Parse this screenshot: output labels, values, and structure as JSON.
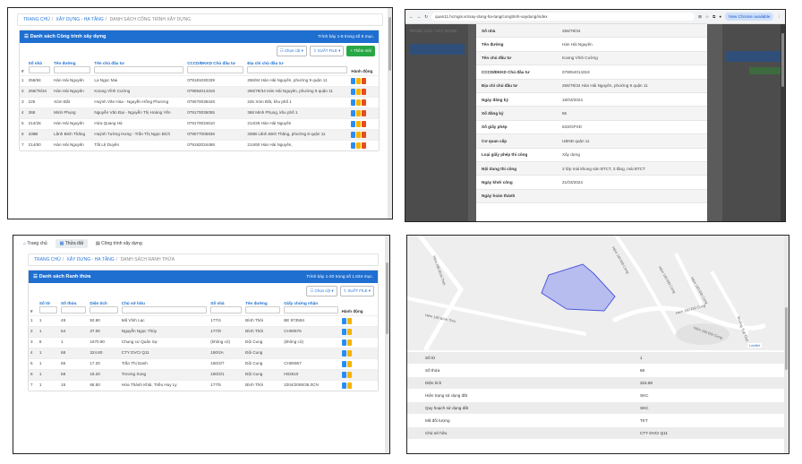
{
  "colors": {
    "primary": "#1f6fd1",
    "success": "#28a745",
    "warning": "#f5b400",
    "danger": "#e84c1e"
  },
  "panel1": {
    "breadcrumb": [
      "TRANG CHỦ",
      "XÂY DỰNG - HẠ TẦNG",
      "DANH SÁCH CÔNG TRÌNH XÂY DỰNG"
    ],
    "title": "Danh sách Công trình xây dựng",
    "count_text": "Trình bày 1-8 trong số 8 mục.",
    "btn_columns": "Chọn cột",
    "btn_export": "XUẤT FILE",
    "btn_add": "+ Thêm mới",
    "columns": [
      "#",
      "Số nhà",
      "Tên đường",
      "Tên chủ đầu tư",
      "CCCD/ĐKKD Chủ đầu tư",
      "Địa chỉ chủ đầu tư",
      "Hành động"
    ],
    "rows": [
      {
        "n": "1",
        "so_nha": "256/84",
        "duong": "Hàn Hải Nguyên",
        "chu": "La Ngọc Mai",
        "cccd": "079181030339",
        "dia_chi": "256/84 Hàn Hải Nguyên, phường 9 quận 11"
      },
      {
        "n": "2",
        "so_nha": "256/78/34",
        "duong": "Hàn Hải Nguyên",
        "chu": "Koong Vĩnh Cường",
        "cccd": "079054014318",
        "dia_chi": "256/78/34 Hàn Hải Nguyên, phường 9 quận 11"
      },
      {
        "n": "3",
        "so_nha": "225",
        "duong": "Xóm Đất",
        "chu": "Huỳnh Văn Hòa - Nguyễn Hồng Phương",
        "cccd": "079070038428",
        "dia_chi": "225 Xóm Đất, khu phố 1"
      },
      {
        "n": "4",
        "so_nha": "368",
        "duong": "Minh Phụng",
        "chu": "Nguyễn Văn Đại - Nguyễn Thị Hoàng Yến",
        "cccd": "079170035055",
        "dia_chi": "368 Minh Phụng, khu phố 1"
      },
      {
        "n": "5",
        "so_nha": "214/26",
        "duong": "Hàn Hải Nguyên",
        "chu": "Hứa Quang Hà",
        "cccd": "079170034610",
        "dia_chi": "214/26 Hàn Hải Nguyên"
      },
      {
        "n": "6",
        "so_nha": "339B",
        "duong": "Lãnh Binh Thăng",
        "chu": "Huỳnh Tường Hưng - Trần Thị Ngọc Bích",
        "cccd": "079077005938",
        "dia_chi": "339B Lãnh Binh Thăng, phường 8 quận 11"
      },
      {
        "n": "7",
        "so_nha": "214/60",
        "duong": "Hàn Hải Nguyên",
        "chu": "Tất Lệ Duyên",
        "cccd": "079182034488",
        "dia_chi": "214/60 Hàn Hải Nguyên,"
      }
    ]
  },
  "panel2": {
    "url": "quan11.hcmgis.vn/xay-dung-ha-tang/congtrinh-xaydung/index",
    "new_chrome": "New Chrome available",
    "bg_labels": [
      "TRANG CHỦ",
      "XÂY DỰNG"
    ],
    "fields": [
      {
        "k": "Số nhà",
        "v": "256/78/34"
      },
      {
        "k": "Tên đường",
        "v": "Hàn Hải Nguyên"
      },
      {
        "k": "Tên chủ đầu tư",
        "v": "Koong Vĩnh Cường"
      },
      {
        "k": "CCCD/ĐKKD Chủ đầu tư",
        "v": "079054014318"
      },
      {
        "k": "Địa chỉ chủ đầu tư",
        "v": "256/78/34 Hàn Hải Nguyên, phường 9 quận 11"
      },
      {
        "k": "Ngày đăng ký",
        "v": "18/03/2024"
      },
      {
        "k": "Số đăng ký",
        "v": "65"
      },
      {
        "k": "Số giấy phép",
        "v": "633/GPXD"
      },
      {
        "k": "Cơ quan cấp",
        "v": "UBND quận 11"
      },
      {
        "k": "Loại giấy phép thi công",
        "v": "Xây dựng"
      },
      {
        "k": "Nội dung thi công",
        "v": "3 lớp mái khung sàn BTCT, 3 tầng, mái BTCT"
      },
      {
        "k": "Ngày khởi công",
        "v": "21/03/2024"
      },
      {
        "k": "Ngày hoàn thành",
        "v": ""
      }
    ]
  },
  "panel3": {
    "tabs": [
      "Trang chủ",
      "Thửa đất",
      "Công trình xây dựng"
    ],
    "breadcrumb": [
      "TRANG CHỦ",
      "XÂY DỰNG - HẠ TẦNG",
      "DANH SÁCH RANH THỬA"
    ],
    "title": "Danh sách Ranh thửa",
    "count_text": "Trình bày 1-20 trong số 1.634 mục.",
    "btn_columns": "Chọn cột",
    "btn_export": "XUẤT FILE",
    "columns": [
      "#",
      "Số tờ",
      "Số thửa",
      "Diện tích",
      "Chủ sở hữu",
      "Số nhà",
      "Tên đường",
      "Giấy chứng nhận",
      "Hành động"
    ],
    "rows": [
      {
        "n": "1",
        "to": "1",
        "thua": "49",
        "dt": "92.60",
        "chu": "Mã Vĩnh Lạc",
        "nha": "177/4",
        "duong": "Bình Thới",
        "gcn": "BE 973584"
      },
      {
        "n": "2",
        "to": "1",
        "thua": "54",
        "dt": "37.00",
        "chu": "Nguyễn Ngọc Thủy",
        "nha": "177/8",
        "duong": "Bình Thới",
        "gcn": "CH00576"
      },
      {
        "n": "3",
        "to": "8",
        "thua": "1",
        "dt": "1670.90",
        "chu": "Chung cư Quân Sự",
        "nha": "(không có)",
        "duong": "Đội Cung",
        "gcn": "(không có)"
      },
      {
        "n": "4",
        "to": "1",
        "thua": "68",
        "dt": "324.80",
        "chu": "CTY DVCI Q11",
        "nha": "160/2A",
        "duong": "Đội Cung",
        "gcn": ""
      },
      {
        "n": "5",
        "to": "1",
        "thua": "55",
        "dt": "17.20",
        "chu": "Trần Thị Danh",
        "nha": "160/2/7",
        "duong": "Đội Cung",
        "gcn": "CH00957"
      },
      {
        "n": "6",
        "to": "1",
        "thua": "58",
        "dt": "18.20",
        "chu": "Trương Xung",
        "nha": "160/2/1",
        "duong": "Đội Cung",
        "gcn": "H02510"
      },
      {
        "n": "7",
        "to": "1",
        "thua": "15",
        "dt": "68.50",
        "chu": "Hứa Thành Khải, Triều Huy Ly",
        "nha": "177/5",
        "duong": "Bình Thới",
        "gcn": "2204/2006/36.0CN"
      }
    ]
  },
  "panel4": {
    "map_labels": [
      "Hẻm 180 Bình Thới",
      "Hẻm 160 Đội Cung",
      "Hẻm 160 Đội Cung",
      "Hẻm 160 Đội Cung",
      "Hẻm 180 Bình Thới",
      "Hẻm 160 Đội Cung",
      "Hẻm 160 Đội Cung",
      "Đường Tuệ Tĩnh"
    ],
    "map_attribution": "Leaflet",
    "fields": [
      {
        "k": "Số tờ",
        "v": "1"
      },
      {
        "k": "Số thửa",
        "v": "68"
      },
      {
        "k": "Diện tích",
        "v": "324.80"
      },
      {
        "k": "Hiện trạng sử dụng đất",
        "v": "SKC"
      },
      {
        "k": "Quy hoạch sử dụng đất",
        "v": "SKC"
      },
      {
        "k": "Mã đối tượng",
        "v": "TKT"
      },
      {
        "k": "Chủ sở hữu",
        "v": "CTY DVCI Q11"
      }
    ]
  }
}
